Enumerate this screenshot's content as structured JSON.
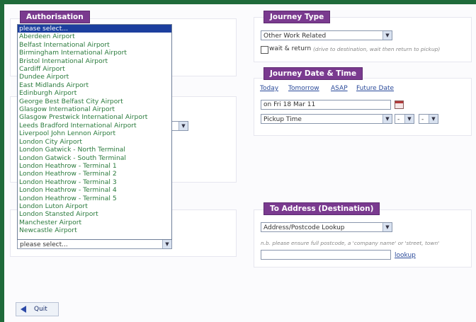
{
  "authorisation": {
    "title": "Authorisation",
    "dropdown_options": [
      "please select...",
      "Aberdeen Airport",
      "Belfast International Airport",
      "Birmingham International Airport",
      "Bristol International Airport",
      "Cardiff Airport",
      "Dundee Airport",
      "East Midlands Airport",
      "Edinburgh Airport",
      "George Best Belfast City Airport",
      "Glasgow International Airport",
      "Glasgow Prestwick International Airport",
      "Leeds Bradford International Airport",
      "Liverpool John Lennon Airport",
      "London City Airport",
      "London Gatwick - North Terminal",
      "London Gatwick - South Terminal",
      "London Heathrow - Terminal 1",
      "London Heathrow - Terminal 2",
      "London Heathrow - Terminal 3",
      "London Heathrow - Terminal 4",
      "London Heathrow - Terminal 5",
      "London Luton Airport",
      "London Stansted Airport",
      "Manchester Airport",
      "Newcastle Airport"
    ],
    "selected_index": 0,
    "select_value": "please select..."
  },
  "journey_type": {
    "title": "Journey Type",
    "select_value": "Other Work Related",
    "wait_return_label": "wait & return",
    "wait_return_hint": "(drive to destination, wait then return to pickup)"
  },
  "journey_date": {
    "title": "Journey Date & Time",
    "links": [
      "Today",
      "Tomorrow",
      "ASAP",
      "Future Date"
    ],
    "date_value": "on Fri 18 Mar 11",
    "pickup_time": "Pickup Time",
    "hour": "-",
    "minute": "-"
  },
  "destination": {
    "title": "To Address (Destination)",
    "select_value": "Address/Postcode Lookup",
    "hint": "n.b. please ensure full postcode, a 'company name' or 'street, town'",
    "lookup_label": "lookup"
  },
  "footer": {
    "quit_label": "Quit"
  },
  "colors": {
    "frame": "#1f6a3a",
    "heading": "#7a3a8f",
    "selected": "#1c3f9e",
    "option_text": "#2a7a3c",
    "link": "#2a4a9a"
  }
}
